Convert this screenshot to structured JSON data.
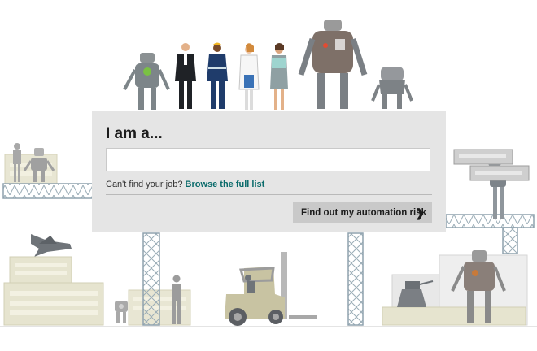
{
  "form": {
    "heading": "I am a...",
    "input_value": "",
    "input_placeholder": "",
    "helper_prefix": "Can't find your job?",
    "helper_link": "Browse the full list",
    "submit_label": "Find out my automation risk",
    "submit_icon": "chevron-right-icon"
  },
  "colors": {
    "panel": "#e5e5e5",
    "button": "#c9c9c9",
    "link": "#0a6b6b",
    "scaffold": "#8fa2ae",
    "crate": "#e6e4cf"
  }
}
